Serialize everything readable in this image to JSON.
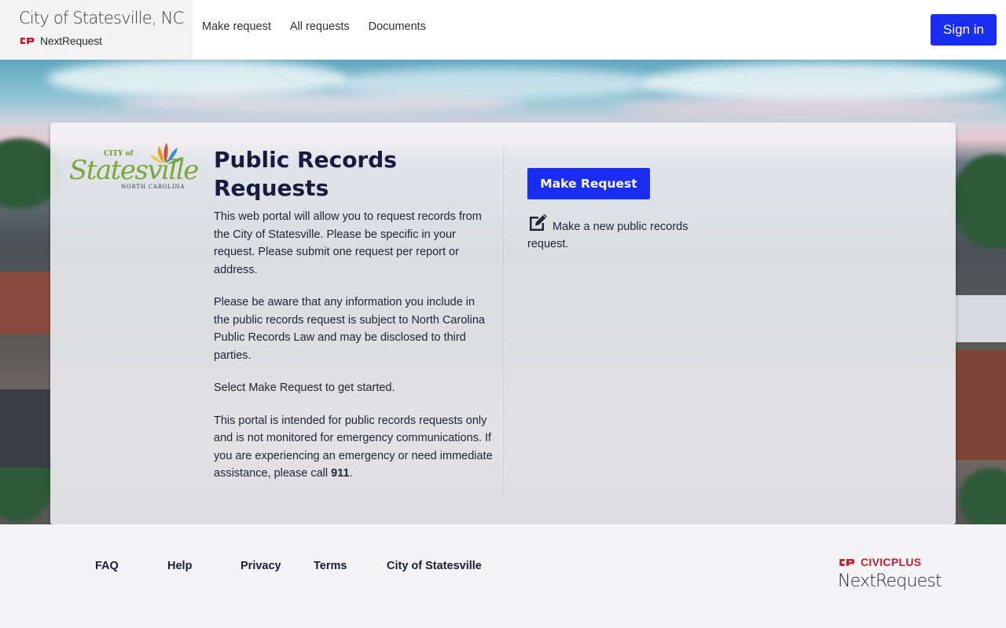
{
  "header": {
    "site_title": "City of Statesville, NC",
    "brand_name": "NextRequest",
    "nav": [
      {
        "label": "Make request"
      },
      {
        "label": "All requests"
      },
      {
        "label": "Documents"
      }
    ],
    "signin_label": "Sign in"
  },
  "card": {
    "logo": {
      "city_of": "CITY of",
      "name": "Statesville",
      "state": "NORTH CAROLINA"
    },
    "title": "Public Records Requests",
    "paragraphs": {
      "p1": "This web portal will allow you to request records from the City of Statesville. Please be specific in your request. Please submit one request per report or address.",
      "p2": "Please be aware that any information you include in the public records request is subject to North Carolina Public Records Law and may be disclosed to third parties.",
      "p3": "Select Make Request to get started.",
      "p4_prefix": "This portal is intended for public records requests only and is not monitored for emergency communications. If you are experiencing an emergency or need immediate assistance, please call ",
      "p4_bold": "911",
      "p4_suffix": "."
    },
    "make_request_label": "Make Request",
    "make_request_desc": "Make a new public records request.",
    "icons": {
      "edit": "edit-icon"
    }
  },
  "footer": {
    "links": [
      {
        "label": "FAQ"
      },
      {
        "label": "Help"
      },
      {
        "label": "Privacy"
      },
      {
        "label": "Terms"
      },
      {
        "label": "City of Statesville"
      }
    ],
    "civic_brand": "CIVICPLUS",
    "civic_product": "NextRequest"
  },
  "colors": {
    "accent": "#1a2ef2",
    "civic_red": "#c01e2e",
    "title_navy": "#161b3f"
  }
}
